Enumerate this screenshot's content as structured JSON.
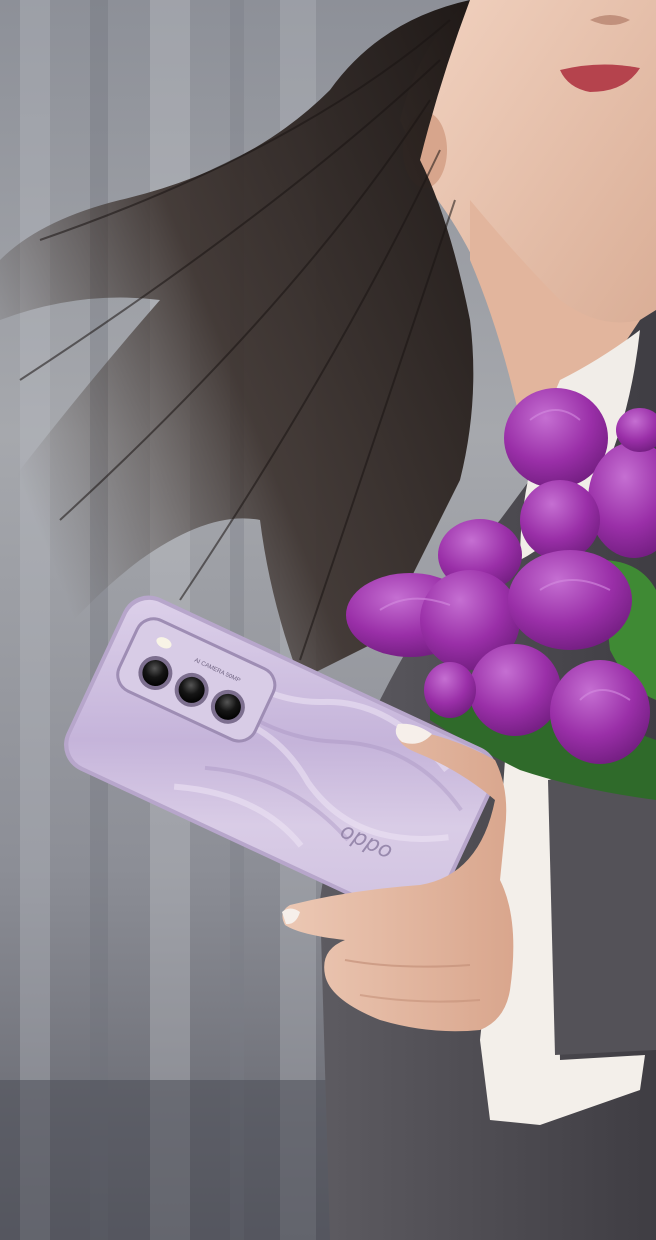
{
  "image": {
    "kind": "product-lifestyle-photo",
    "subject": "woman holding smartphone and tulip bouquet"
  },
  "phone": {
    "brand_logo": "oppo",
    "camera_ring_text": "AI CAMERA 50MP",
    "color": "#c9b8dc",
    "camera_count": 3
  },
  "palette": {
    "background": "#7c7f88",
    "tulip": "#8e2a9e",
    "tulip_light": "#b65bc6",
    "jacket": "#4e4c52",
    "shirt": "#f3efea",
    "hair": "#2b2422",
    "skin": "#e6bca6"
  }
}
